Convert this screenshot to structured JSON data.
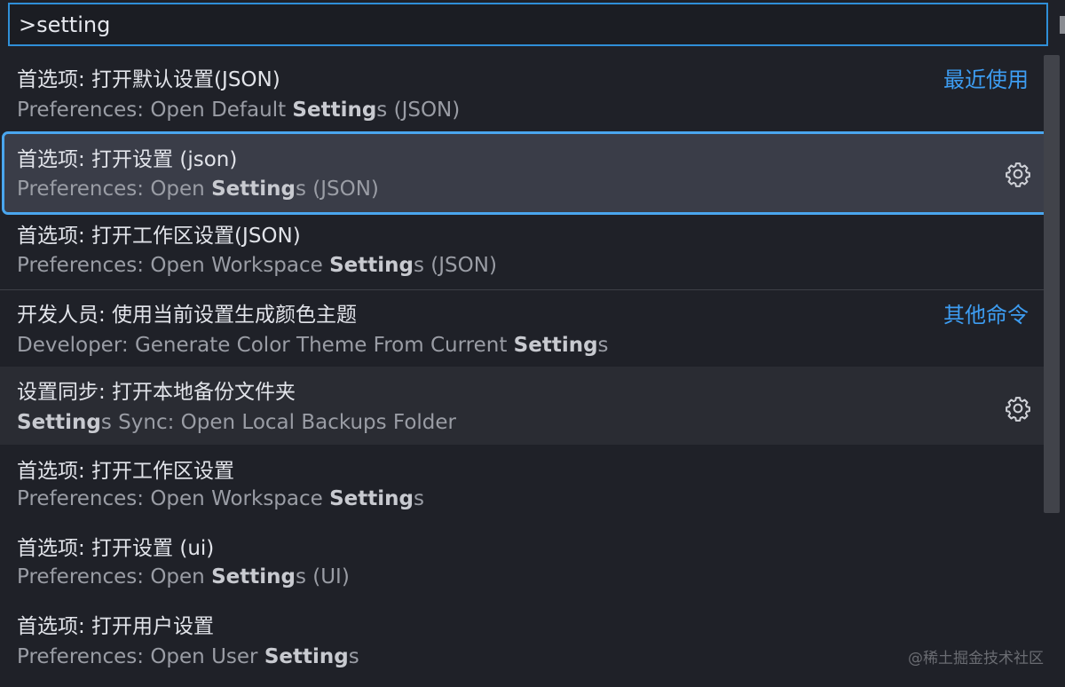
{
  "search": {
    "value": ">setting"
  },
  "groups": {
    "recent": "最近使用",
    "other": "其他命令"
  },
  "items": [
    {
      "label": "首选项: 打开默认设置(JSON)",
      "detail_pre": "Preferences: Open Default ",
      "detail_bold": "Setting",
      "detail_post": "s (JSON)"
    },
    {
      "label": "首选项: 打开设置 (json)",
      "detail_pre": "Preferences: Open ",
      "detail_bold": "Setting",
      "detail_post": "s (JSON)"
    },
    {
      "label": "首选项: 打开工作区设置(JSON)",
      "detail_pre": "Preferences: Open Workspace ",
      "detail_bold": "Setting",
      "detail_post": "s (JSON)"
    },
    {
      "label": "开发人员: 使用当前设置生成颜色主题",
      "detail_pre": "Developer: Generate Color Theme From Current ",
      "detail_bold": "Setting",
      "detail_post": "s"
    },
    {
      "label": "设置同步: 打开本地备份文件夹",
      "detail_pre": "",
      "detail_bold": "Setting",
      "detail_post": "s Sync: Open Local Backups Folder"
    },
    {
      "label": "首选项: 打开工作区设置",
      "detail_pre": "Preferences: Open Workspace ",
      "detail_bold": "Setting",
      "detail_post": "s"
    },
    {
      "label": "首选项: 打开设置 (ui)",
      "detail_pre": "Preferences: Open ",
      "detail_bold": "Setting",
      "detail_post": "s (UI)"
    },
    {
      "label": "首选项: 打开用户设置",
      "detail_pre": "Preferences: Open User ",
      "detail_bold": "Setting",
      "detail_post": "s"
    }
  ],
  "icons": {
    "gear": "gear-icon"
  },
  "colors": {
    "accent": "#3d9df2",
    "selection_border": "#4aa6ee",
    "background": "#1f2128"
  },
  "watermark": "@稀土掘金技术社区"
}
